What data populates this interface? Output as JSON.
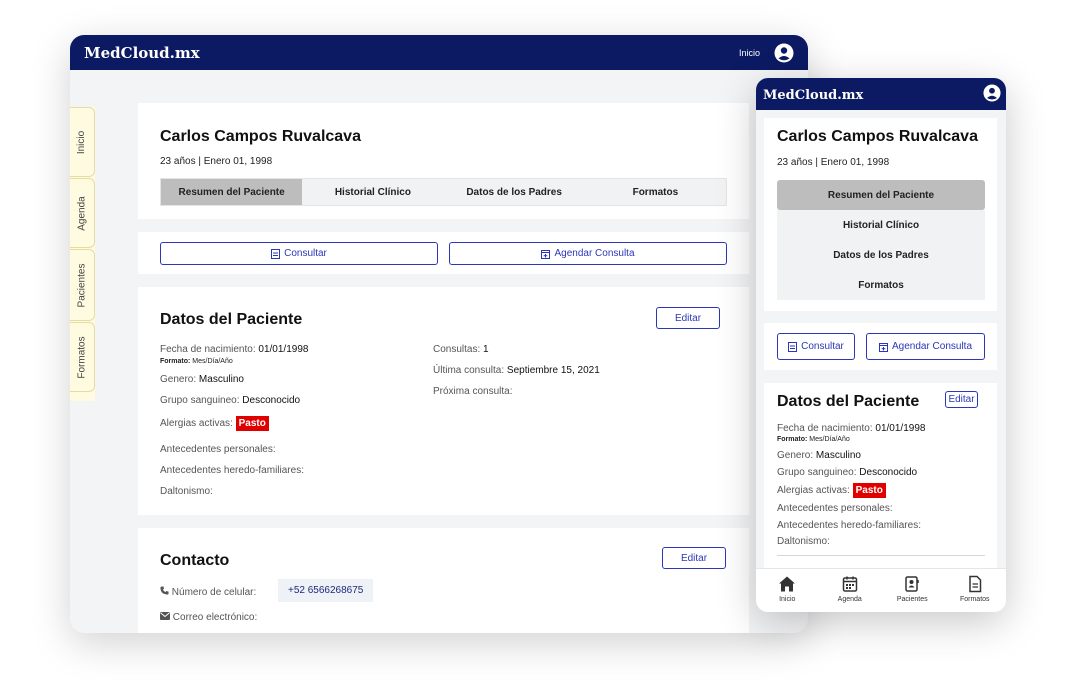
{
  "desktop": {
    "brand": "MedCloud.mx",
    "top_link": "Inicio",
    "sidebar": [
      "Inicio",
      "Agenda",
      "Pacientes",
      "Formatos"
    ],
    "patient": {
      "name": "Carlos Campos Ruvalcava",
      "subtitle": "23 años | Enero 01, 1998"
    },
    "tabs": [
      "Resumen del Paciente",
      "Historial Clínico",
      "Datos de los Padres",
      "Formatos"
    ],
    "actions": {
      "consult": "Consultar",
      "schedule": "Agendar Consulta"
    },
    "datos": {
      "title": "Datos del Paciente",
      "edit": "Editar",
      "birth_label": "Fecha de nacimiento:",
      "birth_value": "01/01/1998",
      "format_label": "Formato:",
      "format_value": "Mes/Día/Año",
      "gender_label": "Genero:",
      "gender_value": "Masculino",
      "blood_label": "Grupo sanguineo:",
      "blood_value": "Desconocido",
      "allergy_label": "Alergias activas:",
      "allergy_value": "Pasto",
      "personal_label": "Antecedentes personales:",
      "hereditary_label": "Antecedentes heredo-familiares:",
      "color_label": "Daltonismo:",
      "consults_label": "Consultas:",
      "consults_value": "1",
      "last_label": "Última consulta:",
      "last_value": "Septiembre 15, 2021",
      "next_label": "Próxima consulta:"
    },
    "contacto": {
      "title": "Contacto",
      "edit": "Editar",
      "phone_label": "Número de celular:",
      "phone_value": "+52 6566268675",
      "email_label": "Correo electrónico:"
    }
  },
  "mobile": {
    "brand": "MedCloud.mx",
    "patient": {
      "name": "Carlos Campos Ruvalcava",
      "subtitle": "23 años | Enero 01, 1998"
    },
    "tabs": [
      "Resumen del Paciente",
      "Historial Clínico",
      "Datos de los Padres",
      "Formatos"
    ],
    "actions": {
      "consult": "Consultar",
      "schedule": "Agendar Consulta"
    },
    "datos": {
      "title": "Datos del Paciente",
      "edit": "Editar",
      "birth_label": "Fecha de nacimiento:",
      "birth_value": "01/01/1998",
      "format_label": "Formato:",
      "format_value": "Mes/Día/Año",
      "gender_label": "Genero:",
      "gender_value": "Masculino",
      "blood_label": "Grupo sanguineo:",
      "blood_value": "Desconocido",
      "allergy_label": "Alergias activas:",
      "allergy_value": "Pasto",
      "personal_label": "Antecedentes personales:",
      "hereditary_label": "Antecedentes heredo-familiares:",
      "color_label": "Daltonismo:"
    },
    "bottom_nav": [
      "Inicio",
      "Agenda",
      "Pacientes",
      "Formatos"
    ]
  },
  "colors": {
    "navy": "#0c1a63",
    "accent": "#2b37b8",
    "allergy": "#e00000",
    "sidebar": "#fffbe0"
  }
}
